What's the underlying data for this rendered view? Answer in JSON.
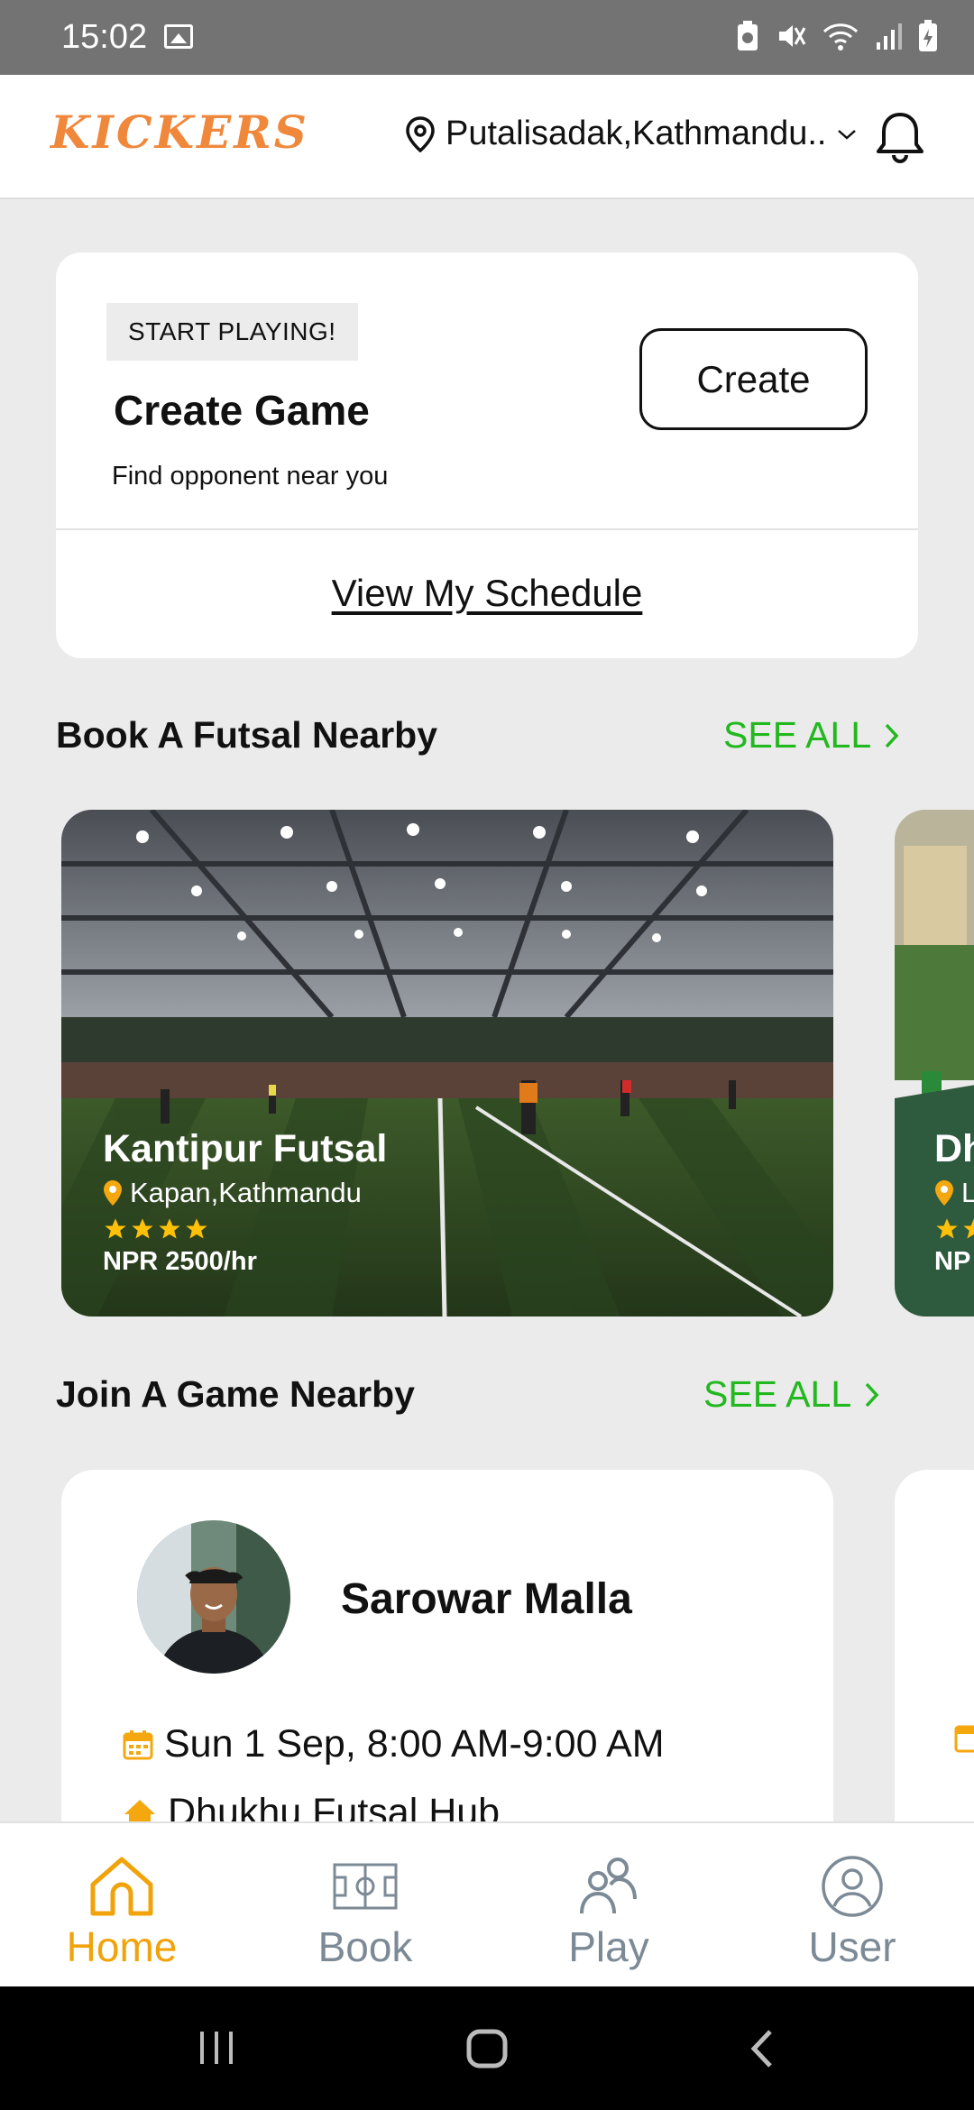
{
  "status_bar": {
    "time": "15:02"
  },
  "header": {
    "logo": "KICKERS",
    "location": "Putalisadak,Kathmandu..",
    "icons": [
      "location-pin-icon",
      "chevron-down-icon",
      "bell-icon"
    ]
  },
  "create_card": {
    "badge": "START PLAYING!",
    "title": "Create Game",
    "subtitle": "Find opponent near you",
    "button": "Create",
    "schedule_link": "View My Schedule"
  },
  "book_section": {
    "title": "Book A Futsal Nearby",
    "see_all": "SEE ALL",
    "cards": [
      {
        "name": "Kantipur Futsal",
        "location": "Kapan,Kathmandu",
        "rating": 4,
        "price": "NPR 2500/hr"
      },
      {
        "name": "Dh",
        "location": "L",
        "rating": 2,
        "price": "NP"
      }
    ]
  },
  "join_section": {
    "title": "Join A Game Nearby",
    "see_all": "SEE ALL",
    "cards": [
      {
        "player": "Sarowar Malla",
        "time": "Sun 1 Sep, 8:00 AM-9:00 AM",
        "venue": "Dhukhu Futsal Hub"
      }
    ]
  },
  "bottom_nav": {
    "items": [
      {
        "label": "Home",
        "icon": "home-icon",
        "active": true
      },
      {
        "label": "Book",
        "icon": "futsal-field-icon",
        "active": false
      },
      {
        "label": "Play",
        "icon": "players-icon",
        "active": false
      },
      {
        "label": "User",
        "icon": "user-icon",
        "active": false
      }
    ]
  },
  "colors": {
    "accent_orange": "#f0a30a",
    "logo_orange": "#f0883c",
    "see_all_green": "#22b81f",
    "star_yellow": "#ffc107"
  }
}
